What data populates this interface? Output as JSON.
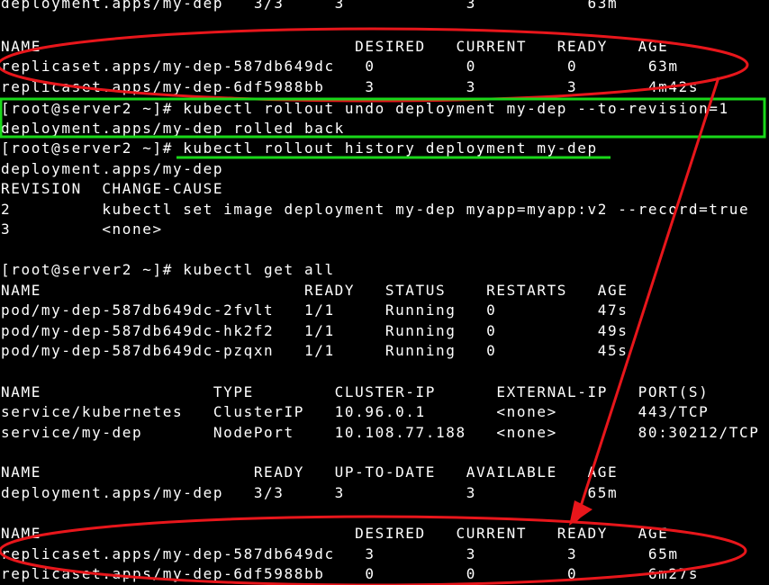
{
  "terminal": {
    "lines": [
      "deployment.apps/my-dep   3/3     3            3           63m",
      "",
      "NAME                               DESIRED   CURRENT   READY   AGE",
      "replicaset.apps/my-dep-587db649dc   0         0         0       63m",
      "replicaset.apps/my-dep-6df5988bb    3         3         3       4m42s",
      "[root@server2 ~]# kubectl rollout undo deployment my-dep --to-revision=1",
      "deployment.apps/my-dep rolled back",
      "[root@server2 ~]# kubectl rollout history deployment my-dep",
      "deployment.apps/my-dep",
      "REVISION  CHANGE-CAUSE",
      "2         kubectl set image deployment my-dep myapp=myapp:v2 --record=true",
      "3         <none>",
      "",
      "[root@server2 ~]# kubectl get all",
      "NAME                          READY   STATUS    RESTARTS   AGE",
      "pod/my-dep-587db649dc-2fvlt   1/1     Running   0          47s",
      "pod/my-dep-587db649dc-hk2f2   1/1     Running   0          49s",
      "pod/my-dep-587db649dc-pzqxn   1/1     Running   0          45s",
      "",
      "NAME                 TYPE        CLUSTER-IP      EXTERNAL-IP   PORT(S)",
      "service/kubernetes   ClusterIP   10.96.0.1       <none>        443/TCP",
      "service/my-dep       NodePort    10.108.77.188   <none>        80:30212/TCP",
      "",
      "NAME                     READY   UP-TO-DATE   AVAILABLE   AGE",
      "deployment.apps/my-dep   3/3     3            3           65m",
      "",
      "NAME                               DESIRED   CURRENT   READY   AGE",
      "replicaset.apps/my-dep-587db649dc   3         3         3       65m",
      "replicaset.apps/my-dep-6df5988bb    0         0         0       6m27s"
    ]
  },
  "annotations": {
    "ellipse_color": "#e8161b",
    "box_color": "#19d719",
    "underline_color": "#19d719",
    "arrow_color": "#e8161b"
  }
}
